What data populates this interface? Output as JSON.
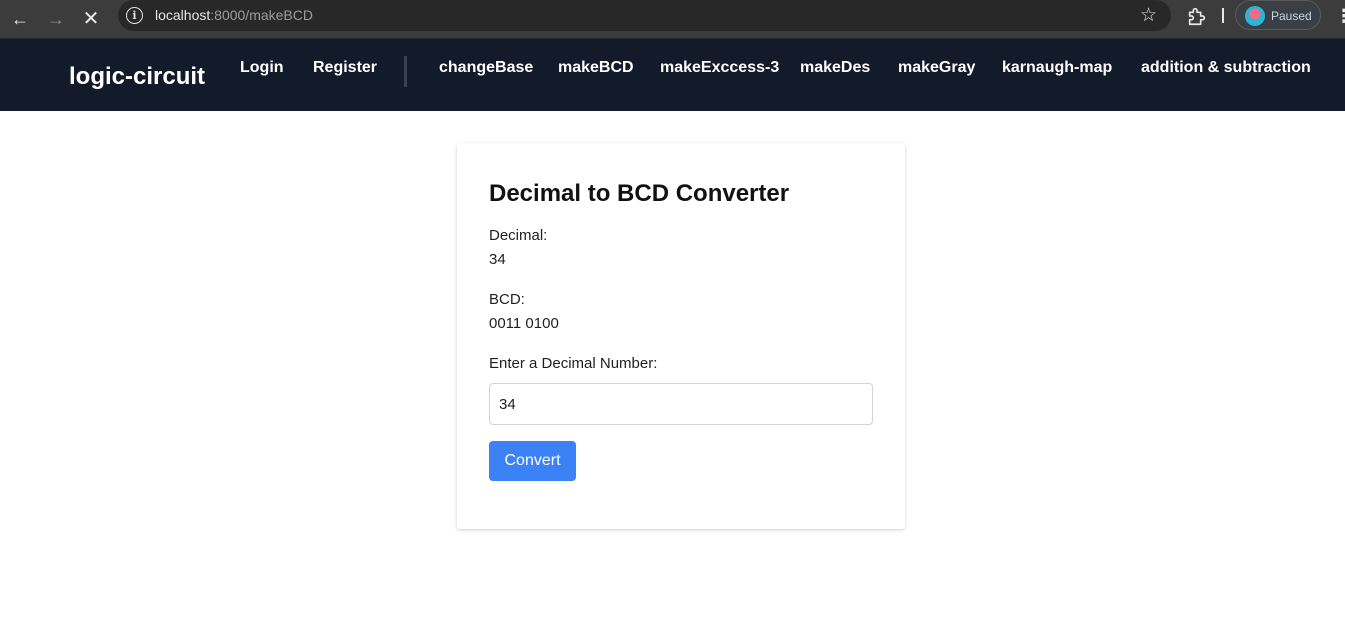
{
  "browser": {
    "url_host": "localhost",
    "url_rest": ":8000/makeBCD",
    "profile_label": "Paused",
    "icons": {
      "back": "back-arrow-icon",
      "forward": "forward-arrow-icon",
      "stop": "close-icon",
      "site_info": "info-icon",
      "bookmark": "star-icon",
      "extensions": "puzzle-icon",
      "menu": "kebab-menu-icon"
    }
  },
  "navbar": {
    "brand": "logic-circuit",
    "auth_links": [
      "Login",
      "Register"
    ],
    "tool_links": [
      "changeBase",
      "makeBCD",
      "makeExccess-3",
      "makeDes",
      "makeGray",
      "karnaugh-map",
      "addition & subtraction"
    ],
    "bg_color": "#131a29"
  },
  "converter": {
    "title": "Decimal to BCD Converter",
    "decimal_label": "Decimal:",
    "decimal_value": "34",
    "bcd_label": "BCD:",
    "bcd_value": "0011 0100",
    "input_label": "Enter a Decimal Number:",
    "input_value": "34",
    "button_label": "Convert",
    "button_color": "#3b82f6"
  }
}
